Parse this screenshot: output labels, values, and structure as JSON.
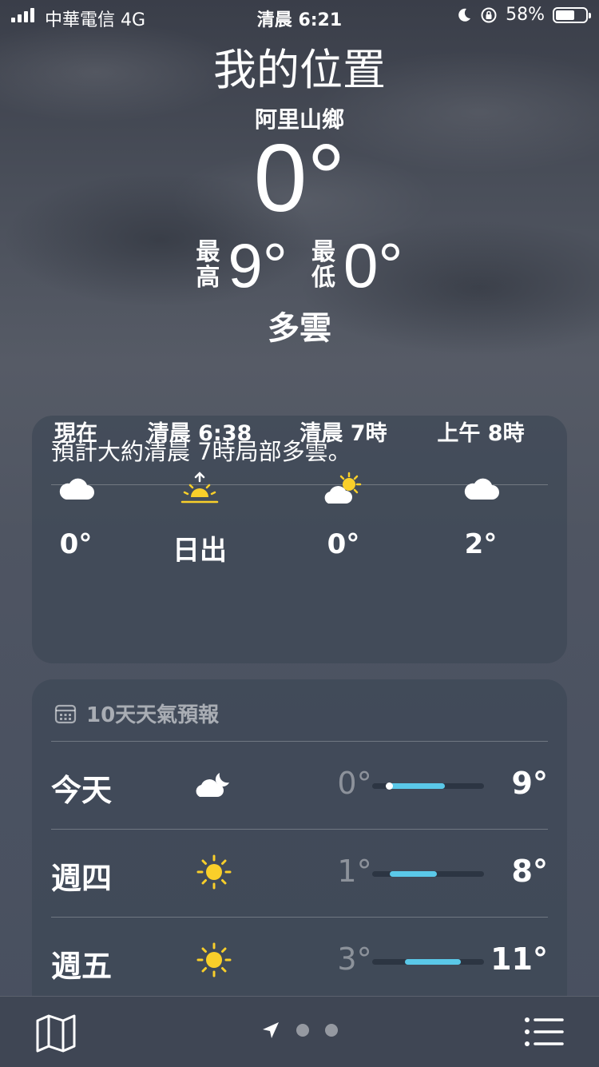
{
  "status": {
    "carrier": "中華電信  4G",
    "time": "清晨 6:21",
    "battery": "58%"
  },
  "header": {
    "title": "我的位置",
    "subtitle": "阿里山鄉",
    "temperature": "0°",
    "high_label": "最高",
    "high": "9°",
    "low_label": "最低",
    "low": "0°",
    "condition": "多雲"
  },
  "hourly": {
    "summary": "預計大約清晨 7時局部多雲。",
    "items": [
      {
        "label": "現在",
        "icon": "cloud-icon",
        "value": "0°"
      },
      {
        "label": "清晨 6:38",
        "icon": "sunrise-icon",
        "value": "日出"
      },
      {
        "label": "清晨 7時",
        "icon": "partly-sunny-icon",
        "value": "0°"
      },
      {
        "label": "上午 8時",
        "icon": "cloud-icon",
        "value": "2°"
      }
    ]
  },
  "forecast": {
    "title": "10天天氣預報",
    "days": [
      {
        "day": "今天",
        "icon": "cloudy-night-icon",
        "low": "0°",
        "high": "9°",
        "range_start": 0.15,
        "range_end": 0.65,
        "current": 0.15
      },
      {
        "day": "週四",
        "icon": "sun-icon",
        "low": "1°",
        "high": "8°",
        "range_start": 0.16,
        "range_end": 0.58
      },
      {
        "day": "週五",
        "icon": "sun-icon",
        "low": "3°",
        "high": "11°",
        "range_start": 0.29,
        "range_end": 0.79
      }
    ]
  },
  "colors": {
    "range_bar": "#5ac8e8",
    "sun": "#f9cf2a"
  }
}
